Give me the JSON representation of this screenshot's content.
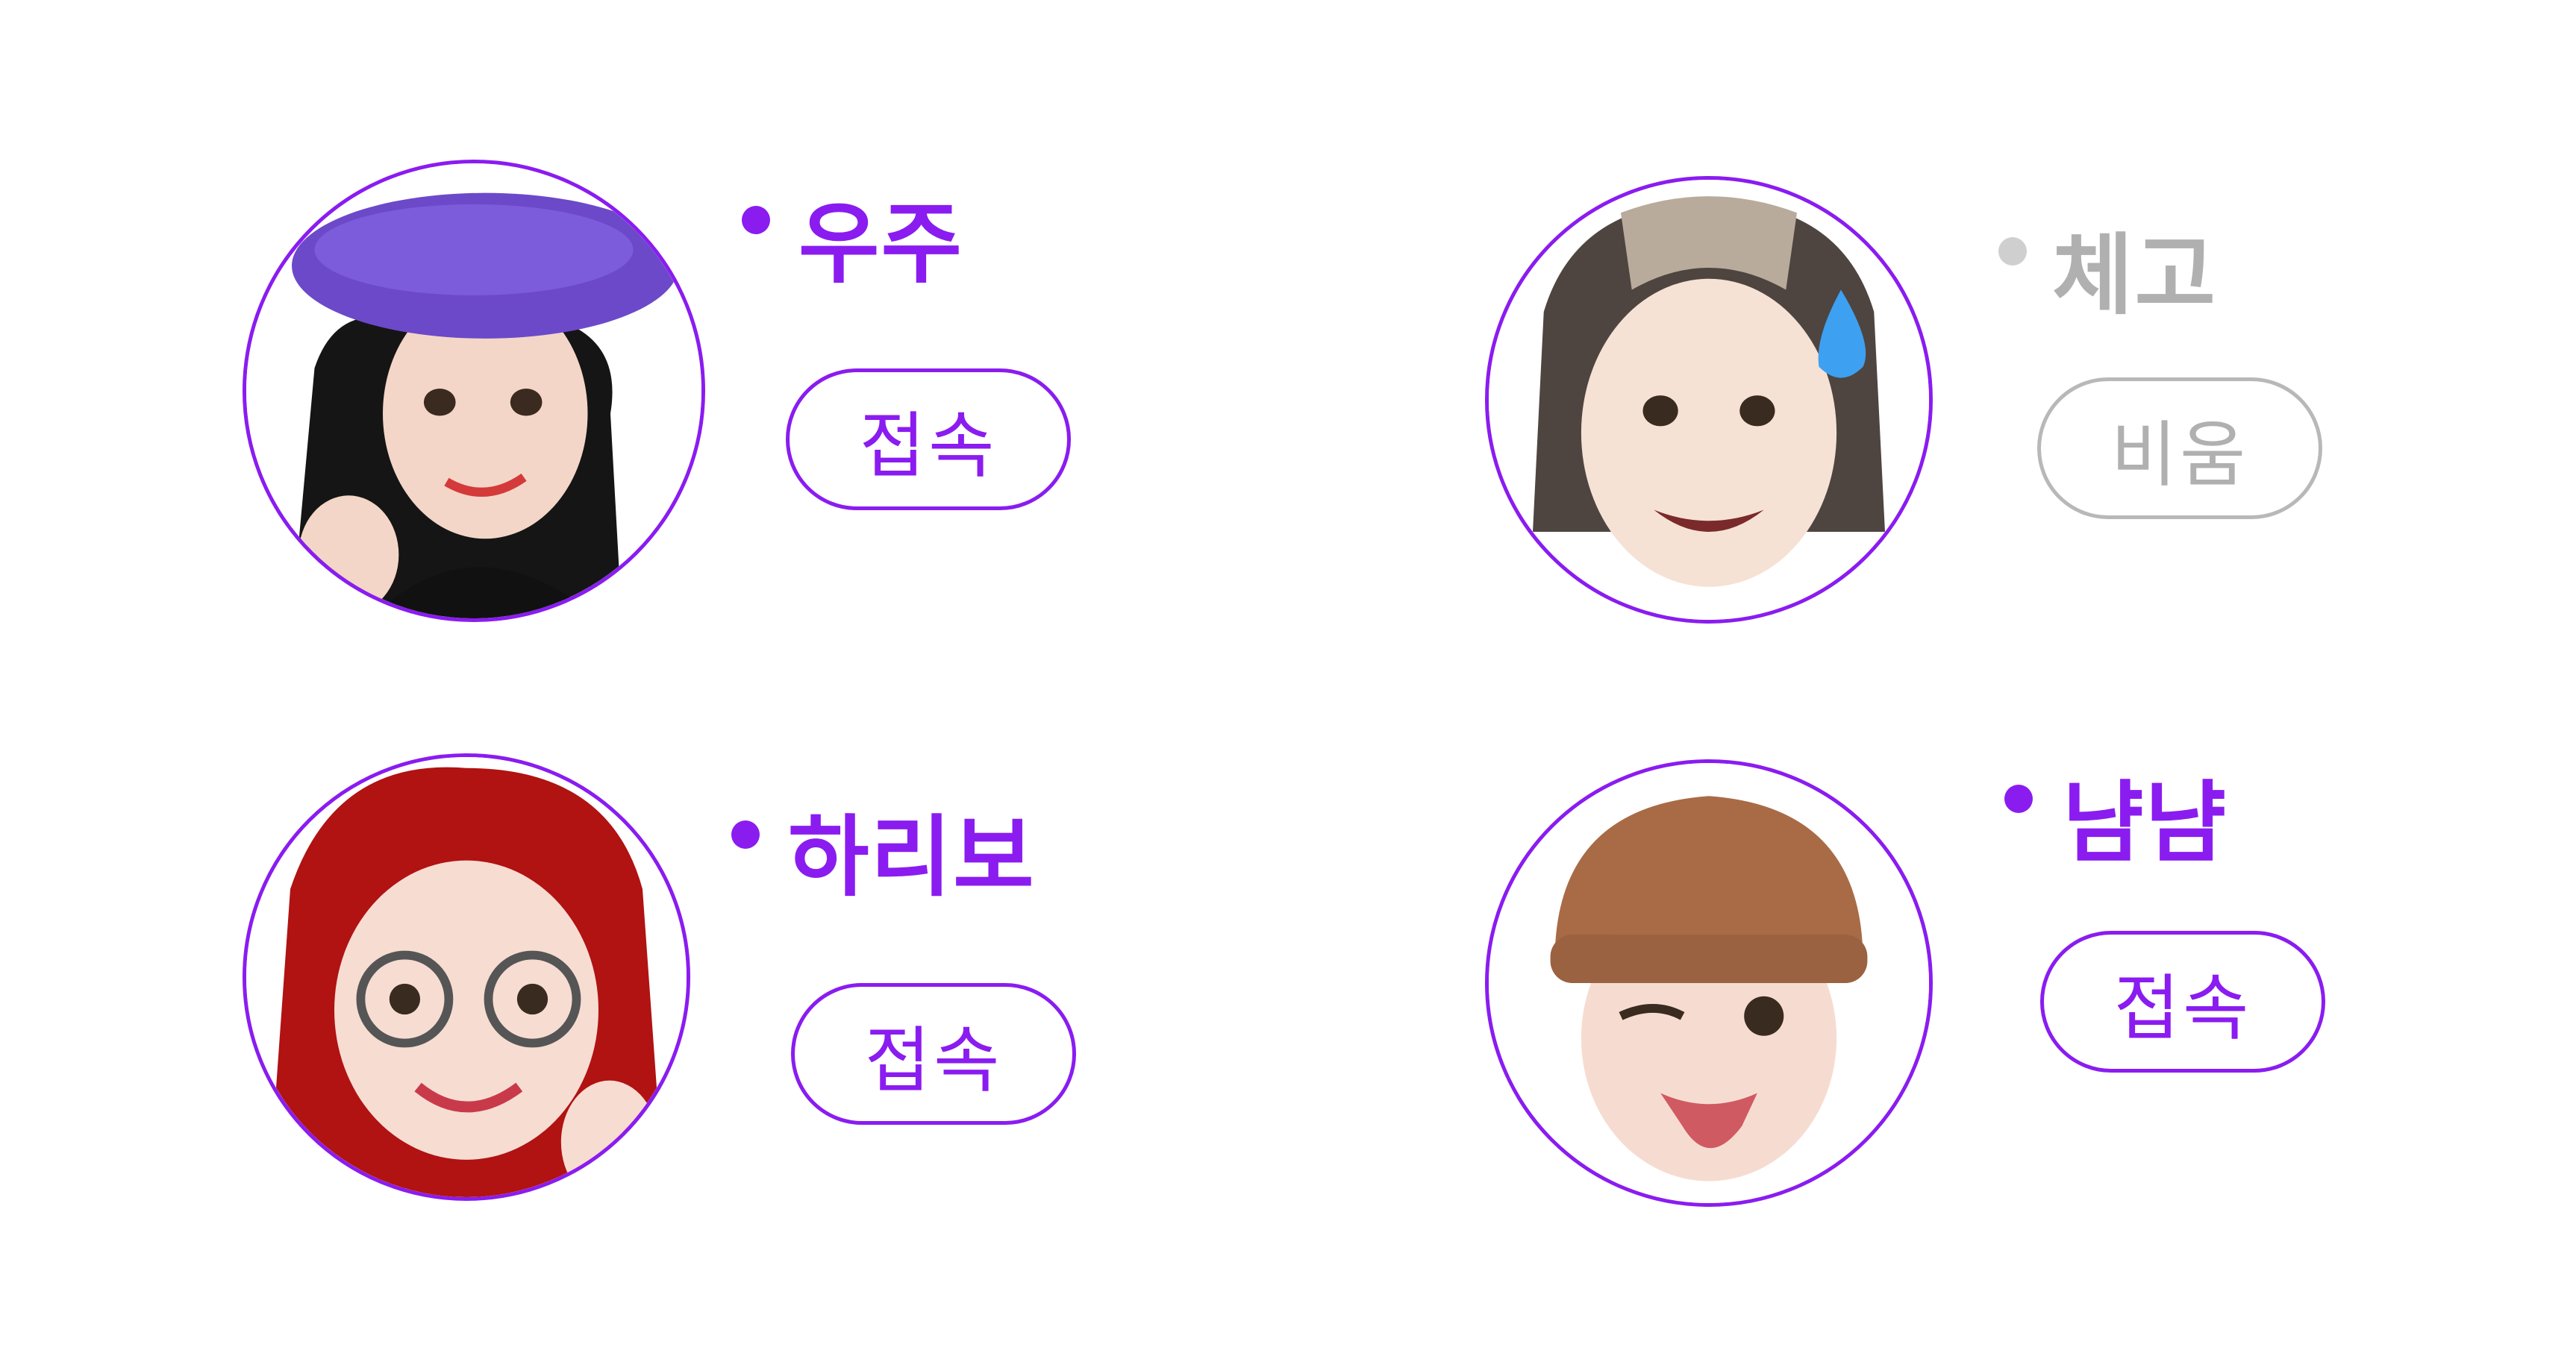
{
  "colors": {
    "accent": "#8a1cf0",
    "inactive": "#b0b0b0"
  },
  "users": [
    {
      "name": "우주",
      "status": "online",
      "status_icon": "status-dot-icon",
      "button_label": "접속",
      "avatar": "memoji-purple-beret"
    },
    {
      "name": "체고",
      "status": "offline",
      "status_icon": "status-dot-icon",
      "button_label": "비움",
      "avatar": "memoji-sweat-drop"
    },
    {
      "name": "하리보",
      "status": "online",
      "status_icon": "status-dot-icon",
      "button_label": "접속",
      "avatar": "memoji-red-hair-glasses"
    },
    {
      "name": "냠냠",
      "status": "online",
      "status_icon": "status-dot-icon",
      "button_label": "접속",
      "avatar": "memoji-brown-beanie-wink"
    }
  ]
}
